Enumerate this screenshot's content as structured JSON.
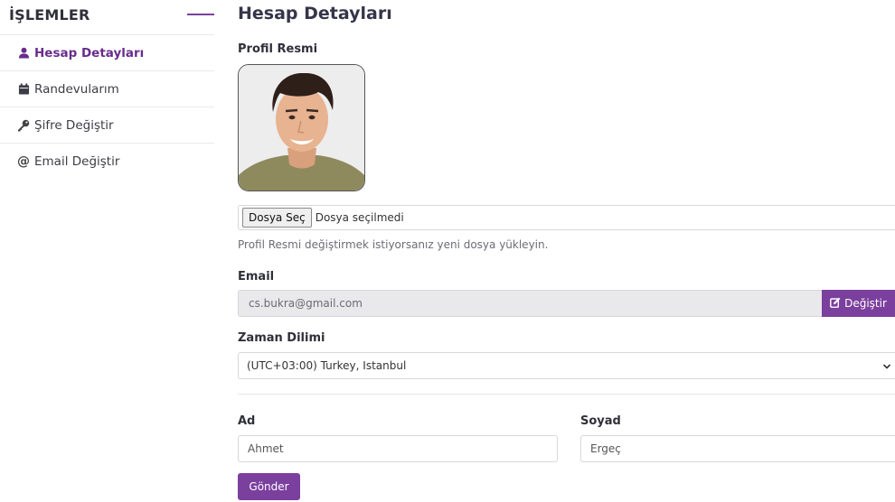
{
  "sidebar": {
    "title": "İŞLEMLER",
    "items": [
      {
        "label": "Hesap Detayları",
        "icon": "user-icon",
        "active": true
      },
      {
        "label": "Randevularım",
        "icon": "calendar-icon",
        "active": false
      },
      {
        "label": "Şifre Değiştir",
        "icon": "key-icon",
        "active": false
      },
      {
        "label": "Email Değiştir",
        "icon": "at-icon",
        "active": false
      }
    ]
  },
  "main": {
    "title": "Hesap Detayları",
    "profile": {
      "label": "Profil Resmi",
      "file_button": "Dosya Seç",
      "file_status": "Dosya seçilmedi",
      "help": "Profil Resmi değiştirmek istiyorsanız yeni dosya yükleyin."
    },
    "email": {
      "label": "Email",
      "value": "cs.bukra@gmail.com",
      "change_button": "Değiştir"
    },
    "timezone": {
      "label": "Zaman Dilimi",
      "selected": "(UTC+03:00) Turkey, Istanbul"
    },
    "first_name": {
      "label": "Ad",
      "value": "Ahmet"
    },
    "last_name": {
      "label": "Soyad",
      "value": "Ergeç"
    },
    "submit": "Gönder"
  },
  "colors": {
    "accent": "#7b3f9e",
    "active_text": "#6a2c8c",
    "readonly_bg": "#e9e9ec"
  }
}
